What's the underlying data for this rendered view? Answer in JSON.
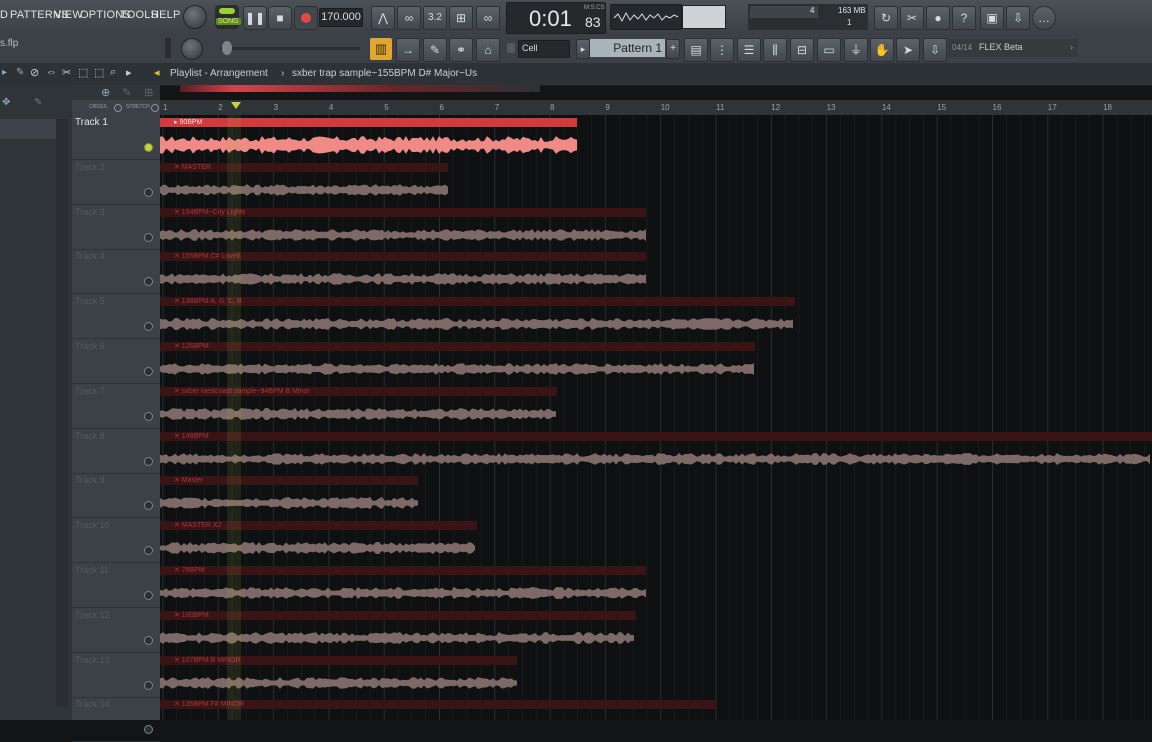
{
  "menu": [
    "D",
    "PATTERNS",
    "VIEW",
    "OPTIONS",
    "TOOLS",
    "HELP"
  ],
  "file_name": "s.flp",
  "transport": {
    "song_label": "SONG",
    "tempo": "170.000",
    "time": "0:01",
    "time_frac": "83",
    "time_unit": "M:S:CS"
  },
  "monitor": {
    "cpu": "4",
    "memory": "163 MB",
    "polyphony": "1"
  },
  "snap_label": "Cell",
  "pattern_label": "Pattern 1",
  "plugin_hint": {
    "slot": "04/14",
    "name": "FLEX Beta"
  },
  "playlist": {
    "title": "Playlist - Arrangement",
    "separator": "›",
    "clip_name": "sxber trap sample~155BPM D# Major~Us",
    "cross_label": "CROSS",
    "stretch_label": "STRETCH"
  },
  "ruler": [
    "1",
    "2",
    "3",
    "4",
    "5",
    "6",
    "7",
    "8",
    "9",
    "10",
    "11",
    "12",
    "13",
    "14",
    "15",
    "16",
    "17",
    "18"
  ],
  "tracks": [
    {
      "name": "Track 1",
      "clip": "90BPM",
      "end_frac": 0.42,
      "selected": true
    },
    {
      "name": "Track 2",
      "clip": "MASTER",
      "end_frac": 0.29
    },
    {
      "name": "Track 3",
      "clip": "154BPM~City Lights",
      "end_frac": 0.49
    },
    {
      "name": "Track 4",
      "clip": "155BPM C# Lovell",
      "end_frac": 0.49
    },
    {
      "name": "Track 5",
      "clip": "138BPM A, G, C, B",
      "end_frac": 0.64
    },
    {
      "name": "Track 6",
      "clip": "126BPM",
      "end_frac": 0.6
    },
    {
      "name": "Track 7",
      "clip": "sxber westcoast sample~94BPM B Minor",
      "end_frac": 0.4
    },
    {
      "name": "Track 8",
      "clip": "148BPM",
      "end_frac": 1.0
    },
    {
      "name": "Track 9",
      "clip": "Master",
      "end_frac": 0.26
    },
    {
      "name": "Track 10",
      "clip": "MASTER X2",
      "end_frac": 0.32
    },
    {
      "name": "Track 11",
      "clip": "76BPM",
      "end_frac": 0.49
    },
    {
      "name": "Track 12",
      "clip": "160BPM",
      "end_frac": 0.48
    },
    {
      "name": "Track 13",
      "clip": "107BPM B MINOR",
      "end_frac": 0.36
    },
    {
      "name": "Track 14",
      "clip": "135BPM F# MINOR",
      "end_frac": 0.56
    }
  ],
  "colors": {
    "accent_clip": "#d23a3e",
    "muted_clip": "#3a1415",
    "wave_selected": "#f08a86",
    "wave_muted": "#7d6a66",
    "playhead": "#c8d43a"
  }
}
